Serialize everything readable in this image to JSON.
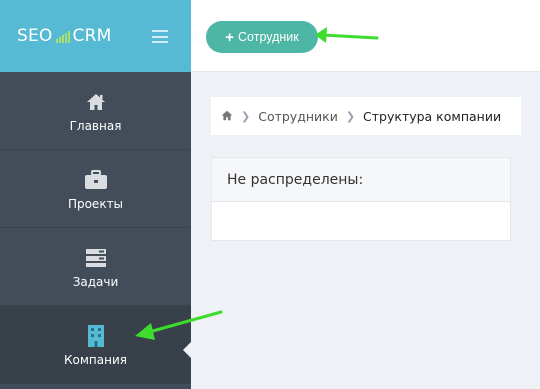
{
  "brand": {
    "left": "SEO",
    "right": "CRM"
  },
  "sidebar": {
    "items": [
      {
        "label": "Главная",
        "icon": "home-icon"
      },
      {
        "label": "Проекты",
        "icon": "briefcase-icon"
      },
      {
        "label": "Задачи",
        "icon": "tasks-icon"
      },
      {
        "label": "Компания",
        "icon": "building-icon",
        "active": true
      }
    ]
  },
  "topbar": {
    "add_button_label": "Сотрудник"
  },
  "breadcrumb": {
    "items": [
      "Сотрудники",
      "Структура компании"
    ]
  },
  "panel": {
    "title": "Не распределены:"
  },
  "colors": {
    "accent": "#57bad5",
    "button": "#4db6a5",
    "sidebar": "#434d5a",
    "arrow": "#3ddc2f"
  }
}
